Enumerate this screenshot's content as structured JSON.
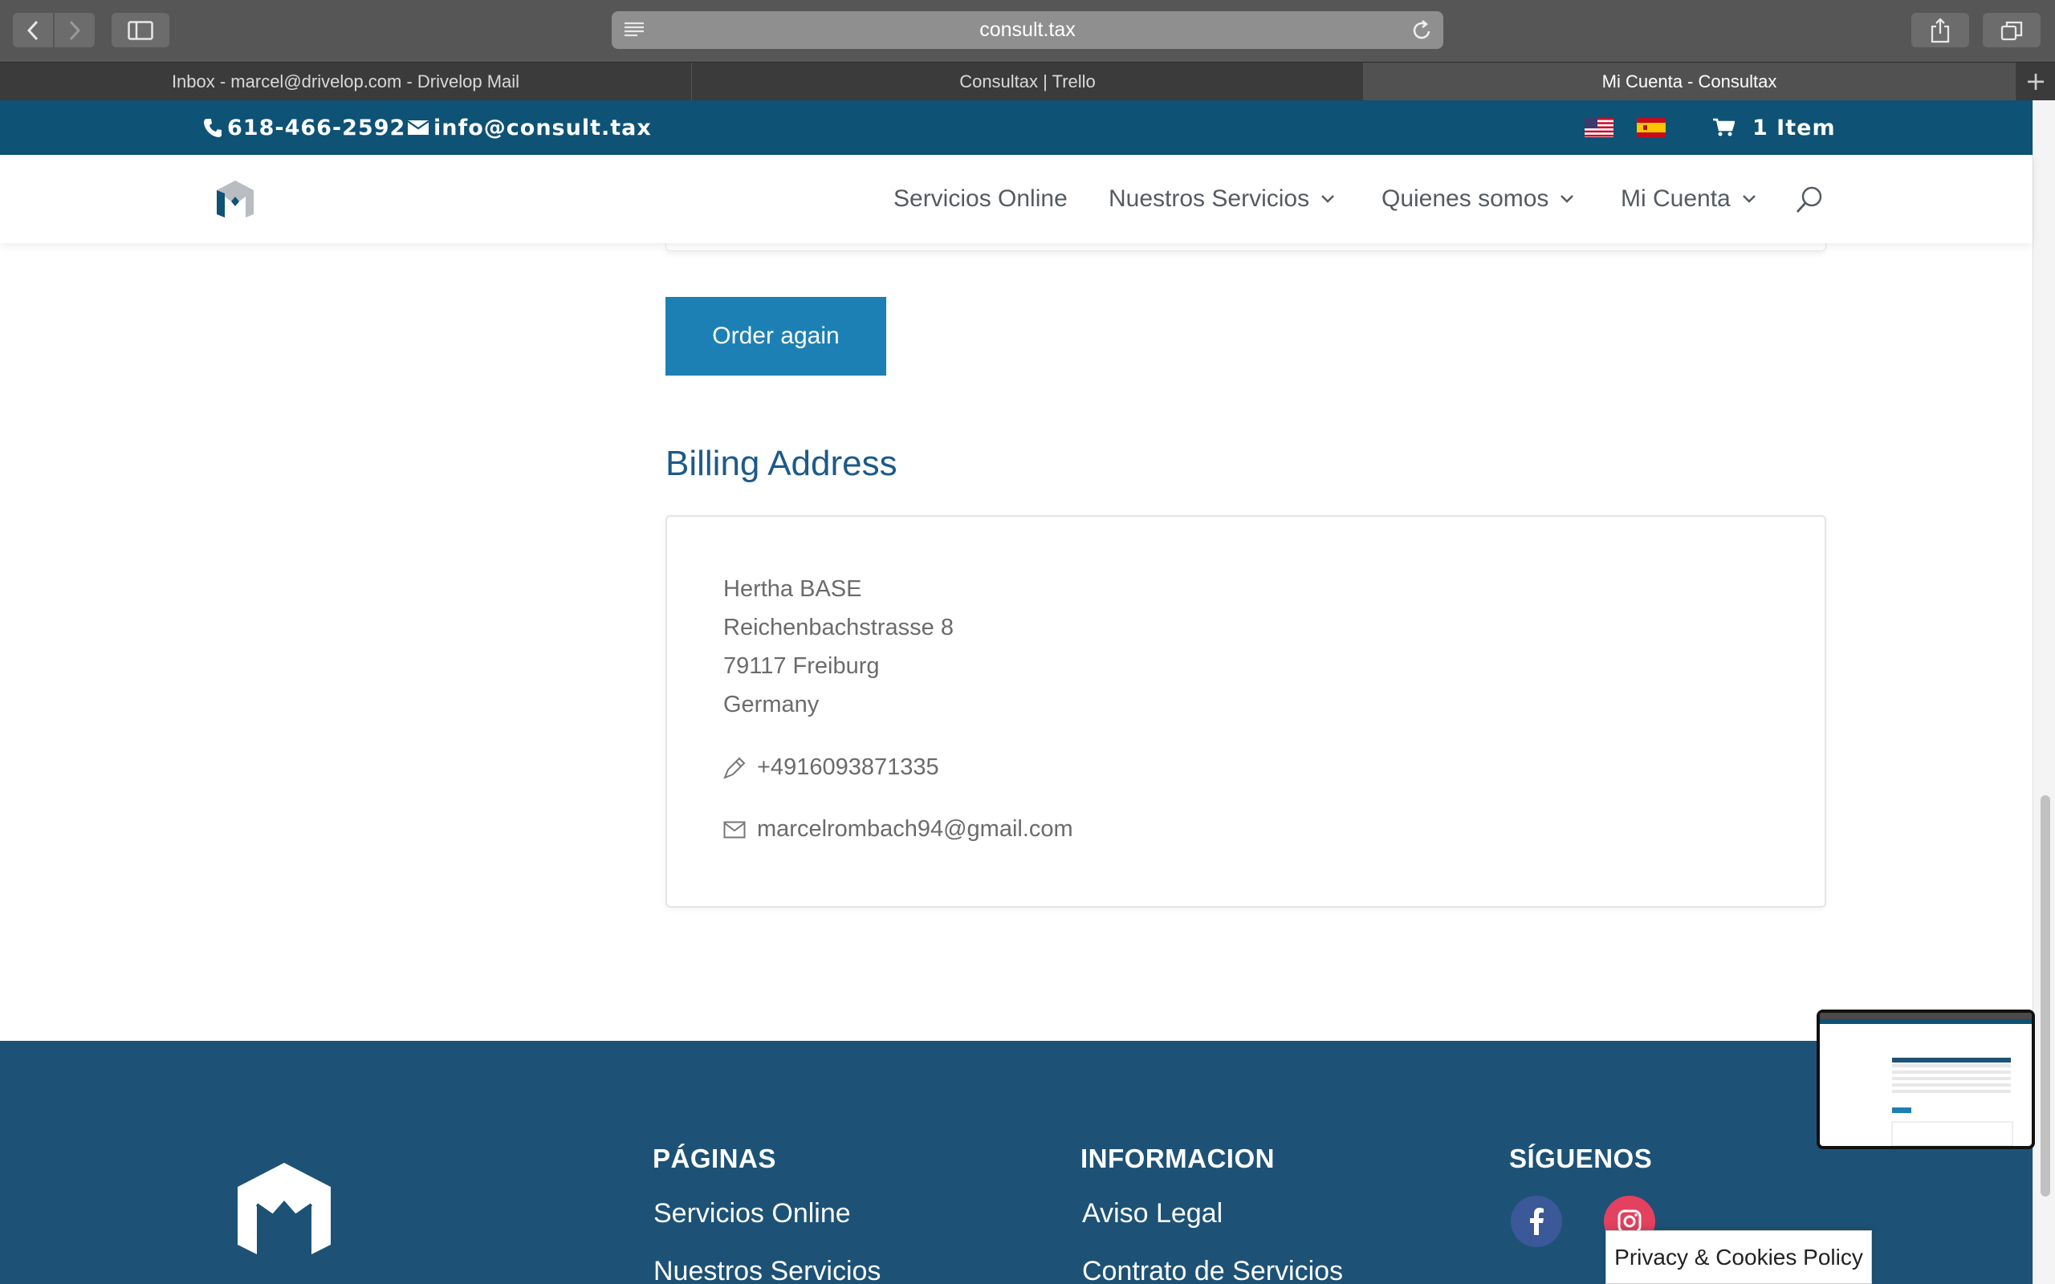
{
  "browser": {
    "url": "consult.tax",
    "tabs": [
      {
        "label": "Inbox - marcel@drivelop.com - Drivelop Mail",
        "active": false
      },
      {
        "label": "Consultax | Trello",
        "active": false
      },
      {
        "label": "Mi Cuenta - Consultax",
        "active": true
      }
    ],
    "icons": [
      "back-icon",
      "forward-icon",
      "sidebar-icon",
      "reader-icon",
      "reload-icon",
      "share-icon",
      "tabs-overview-icon",
      "new-tab-icon"
    ]
  },
  "topbar": {
    "phone": "618-466-2592",
    "email": "info@consult.tax",
    "cart": "1 Item",
    "languages": [
      "en-US flag",
      "es flag"
    ]
  },
  "nav": {
    "items": [
      {
        "label": "Servicios Online",
        "has_dropdown": false
      },
      {
        "label": "Nuestros Servicios",
        "has_dropdown": true
      },
      {
        "label": "Quienes somos",
        "has_dropdown": true
      },
      {
        "label": "Mi Cuenta",
        "has_dropdown": true
      }
    ]
  },
  "main": {
    "order_again_label": "Order again",
    "billing_title": "Billing Address",
    "address": {
      "name": "Hertha BASE",
      "street": "Reichenbachstrasse 8",
      "city": "79117 Freiburg",
      "country": "Germany",
      "phone": "+4916093871335",
      "email": "marcelrombach94@gmail.com"
    }
  },
  "footer": {
    "paginas_title": "PÁGINAS",
    "paginas_links": [
      "Servicios Online",
      "Nuestros Servicios"
    ],
    "info_title": "INFORMACION",
    "info_links": [
      "Aviso Legal",
      "Contrato de Servicios"
    ],
    "social_title": "SÍGUENOS",
    "social": [
      "facebook-icon",
      "instagram-icon"
    ]
  },
  "privacy_label": "Privacy & Cookies Policy",
  "colors": {
    "topbar_bg": "#0e5275",
    "button_bg": "#1d80b4",
    "heading": "#1d5a87",
    "footer_bg": "#1d5276"
  }
}
